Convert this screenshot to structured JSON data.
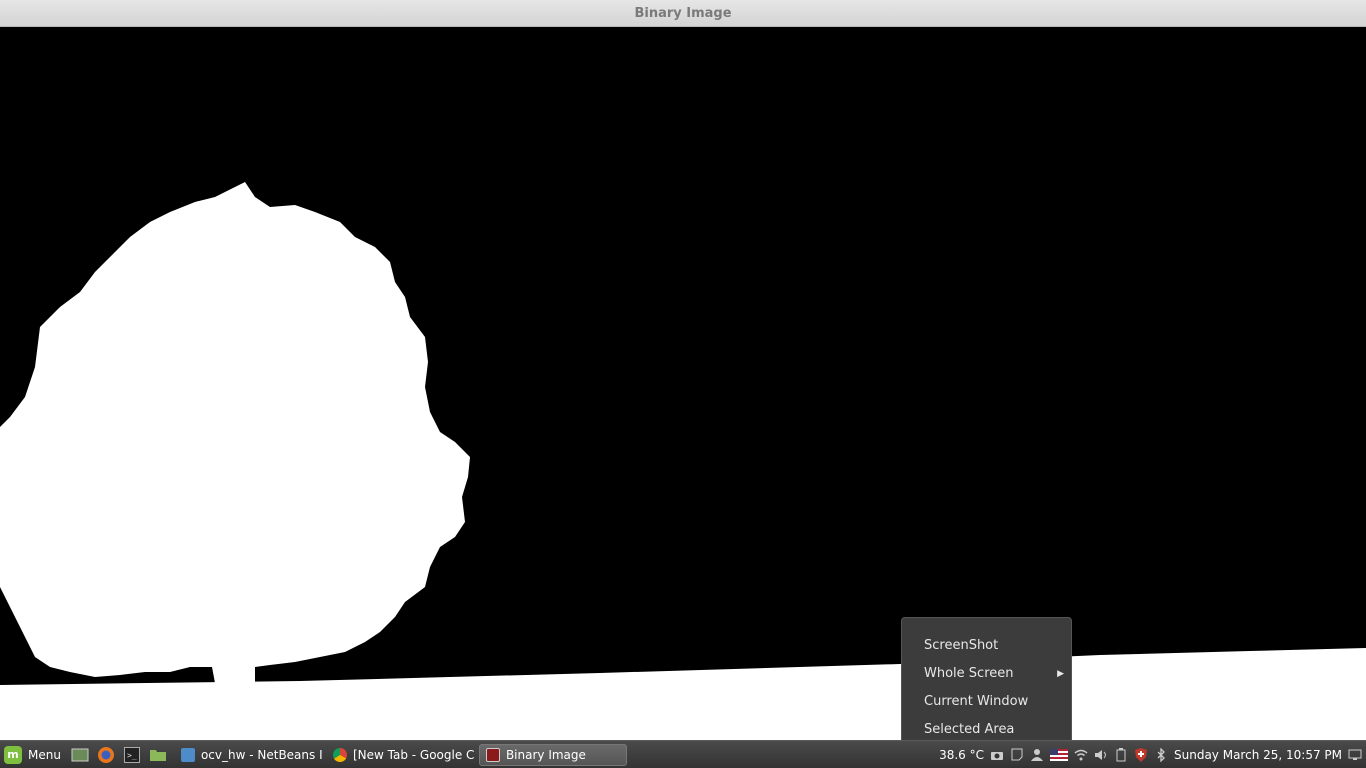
{
  "window": {
    "title": "Binary Image"
  },
  "taskbar": {
    "menu_label": "Menu",
    "launchers": [
      "show-desktop-icon",
      "firefox-icon",
      "terminal-icon",
      "files-icon"
    ],
    "windows": [
      {
        "label": "ocv_hw - NetBeans I...",
        "icon": "netbeans-icon",
        "active": false
      },
      {
        "label": "[New Tab - Google C...",
        "icon": "chrome-icon",
        "active": false
      },
      {
        "label": "Binary Image",
        "icon": "opencv-window-icon",
        "active": true
      }
    ],
    "temperature": "38.6 °C",
    "clock": "Sunday March 25, 10:57 PM"
  },
  "screenshot_menu": {
    "header": "ScreenShot",
    "items": [
      "Whole Screen",
      "Current Window",
      "Selected Area"
    ]
  },
  "colors": {
    "foreground": "#ffffff",
    "background": "#000000",
    "panel": "#3c3c3c"
  }
}
